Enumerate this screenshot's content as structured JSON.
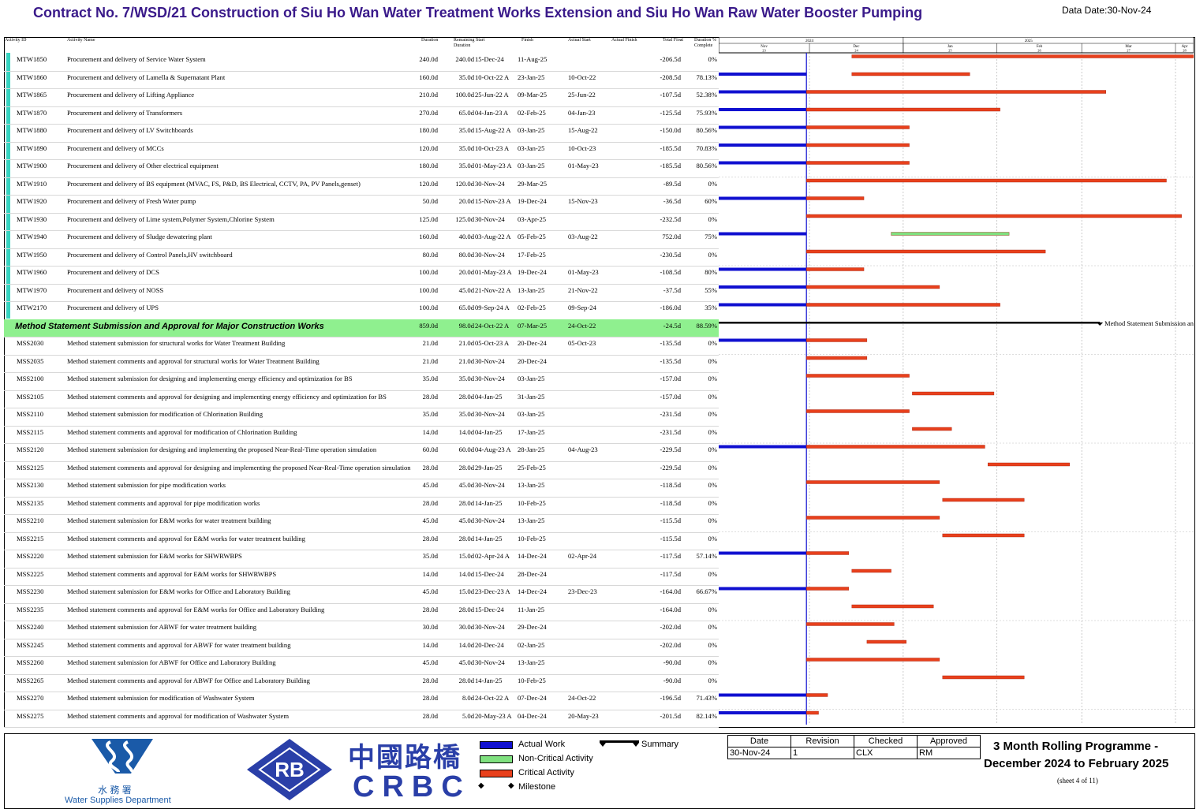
{
  "header": {
    "title": "Contract No. 7/WSD/21 Construction of Siu Ho Wan Water Treatment Works Extension and Siu Ho Wan Raw Water Booster Pumping",
    "data_date": "Data Date:30-Nov-24"
  },
  "columns": [
    "Activity ID",
    "Activity Name",
    "Duration",
    "Remaining Duration",
    "Start",
    "Finish",
    "Actual Start",
    "Actual Finish",
    "Total Float",
    "Duration % Complete"
  ],
  "timescale": {
    "years": [
      "2024",
      "2025"
    ],
    "months": [
      "Nov",
      "Dec",
      "Jan",
      "Feb",
      "Mar",
      "Apr"
    ],
    "months_num": [
      "23",
      "24",
      "25",
      "26",
      "27",
      "28"
    ]
  },
  "rows": [
    {
      "id": "MTW1850",
      "name": "Procurement and delivery of Service Water System",
      "od": "240.0d",
      "rd": "240.0d",
      "start": "15-Dec-24",
      "finish": "11-Aug-25",
      "as": "",
      "af": "",
      "tf": "-206.5d",
      "pc": "0%"
    },
    {
      "id": "MTW1860",
      "name": "Procurement and delivery of Lamella & Supernatant Plant",
      "od": "160.0d",
      "rd": "35.0d",
      "start": "10-Oct-22 A",
      "finish": "23-Jan-25",
      "as": "10-Oct-22",
      "af": "",
      "tf": "-208.5d",
      "pc": "78.13%"
    },
    {
      "id": "MTW1865",
      "name": "Procurement and delivery of Lifting Appliance",
      "od": "210.0d",
      "rd": "100.0d",
      "start": "25-Jun-22 A",
      "finish": "09-Mar-25",
      "as": "25-Jun-22",
      "af": "",
      "tf": "-107.5d",
      "pc": "52.38%"
    },
    {
      "id": "MTW1870",
      "name": "Procurement and delivery of Transformers",
      "od": "270.0d",
      "rd": "65.0d",
      "start": "04-Jan-23 A",
      "finish": "02-Feb-25",
      "as": "04-Jan-23",
      "af": "",
      "tf": "-125.5d",
      "pc": "75.93%"
    },
    {
      "id": "MTW1880",
      "name": "Procurement and delivery of LV Switchboards",
      "od": "180.0d",
      "rd": "35.0d",
      "start": "15-Aug-22 A",
      "finish": "03-Jan-25",
      "as": "15-Aug-22",
      "af": "",
      "tf": "-150.0d",
      "pc": "80.56%"
    },
    {
      "id": "MTW1890",
      "name": "Procurement and delivery of MCCs",
      "od": "120.0d",
      "rd": "35.0d",
      "start": "10-Oct-23 A",
      "finish": "03-Jan-25",
      "as": "10-Oct-23",
      "af": "",
      "tf": "-185.5d",
      "pc": "70.83%"
    },
    {
      "id": "MTW1900",
      "name": "Procurement and delivery of Other electrical equipment",
      "od": "180.0d",
      "rd": "35.0d",
      "start": "01-May-23 A",
      "finish": "03-Jan-25",
      "as": "01-May-23",
      "af": "",
      "tf": "-185.5d",
      "pc": "80.56%"
    },
    {
      "id": "MTW1910",
      "name": "Procurement and delivery of BS equipment (MVAC, FS, P&D, BS Electrical, CCTV, PA, PV Panels,genset)",
      "od": "120.0d",
      "rd": "120.0d",
      "start": "30-Nov-24",
      "finish": "29-Mar-25",
      "as": "",
      "af": "",
      "tf": "-89.5d",
      "pc": "0%"
    },
    {
      "id": "MTW1920",
      "name": "Procurement and delivery of Fresh Water pump",
      "od": "50.0d",
      "rd": "20.0d",
      "start": "15-Nov-23 A",
      "finish": "19-Dec-24",
      "as": "15-Nov-23",
      "af": "",
      "tf": "-36.5d",
      "pc": "60%"
    },
    {
      "id": "MTW1930",
      "name": "Procurement and delivery of Lime system,Polymer System,Chlorine System",
      "od": "125.0d",
      "rd": "125.0d",
      "start": "30-Nov-24",
      "finish": "03-Apr-25",
      "as": "",
      "af": "",
      "tf": "-232.5d",
      "pc": "0%"
    },
    {
      "id": "MTW1940",
      "name": "Procurement and delivery of Sludge dewatering plant",
      "od": "160.0d",
      "rd": "40.0d",
      "start": "03-Aug-22 A",
      "finish": "05-Feb-25",
      "as": "03-Aug-22",
      "af": "",
      "tf": "752.0d",
      "pc": "75%"
    },
    {
      "id": "MTW1950",
      "name": "Procurement and delivery of Control Panels,HV switchboard",
      "od": "80.0d",
      "rd": "80.0d",
      "start": "30-Nov-24",
      "finish": "17-Feb-25",
      "as": "",
      "af": "",
      "tf": "-230.5d",
      "pc": "0%"
    },
    {
      "id": "MTW1960",
      "name": "Procurement and delivery of DCS",
      "od": "100.0d",
      "rd": "20.0d",
      "start": "01-May-23 A",
      "finish": "19-Dec-24",
      "as": "01-May-23",
      "af": "",
      "tf": "-108.5d",
      "pc": "80%"
    },
    {
      "id": "MTW1970",
      "name": "Procurement and delivery of NOSS",
      "od": "100.0d",
      "rd": "45.0d",
      "start": "21-Nov-22 A",
      "finish": "13-Jan-25",
      "as": "21-Nov-22",
      "af": "",
      "tf": "-37.5d",
      "pc": "55%"
    },
    {
      "id": "MTW2170",
      "name": "Procurement and delivery of UPS",
      "od": "100.0d",
      "rd": "65.0d",
      "start": "09-Sep-24 A",
      "finish": "02-Feb-25",
      "as": "09-Sep-24",
      "af": "",
      "tf": "-186.0d",
      "pc": "35%"
    },
    {
      "id": "",
      "name": "Method Statement Submission and Approval for Major Construction Works",
      "od": "859.0d",
      "rd": "98.0d",
      "start": "24-Oct-22 A",
      "finish": "07-Mar-25",
      "as": "24-Oct-22",
      "af": "",
      "tf": "-24.5d",
      "pc": "88.59%",
      "group": true
    },
    {
      "id": "MSS2030",
      "name": "Method statement submission for structural works for Water Treatment Building",
      "od": "21.0d",
      "rd": "21.0d",
      "start": "05-Oct-23 A",
      "finish": "20-Dec-24",
      "as": "05-Oct-23",
      "af": "",
      "tf": "-135.5d",
      "pc": "0%"
    },
    {
      "id": "MSS2035",
      "name": "Method statement comments and approval for structural works for Water Treatment Building",
      "od": "21.0d",
      "rd": "21.0d",
      "start": "30-Nov-24",
      "finish": "20-Dec-24",
      "as": "",
      "af": "",
      "tf": "-135.5d",
      "pc": "0%"
    },
    {
      "id": "MSS2100",
      "name": "Method statement submission for designing and implementing energy efficiency and optimization for BS",
      "od": "35.0d",
      "rd": "35.0d",
      "start": "30-Nov-24",
      "finish": "03-Jan-25",
      "as": "",
      "af": "",
      "tf": "-157.0d",
      "pc": "0%"
    },
    {
      "id": "MSS2105",
      "name": "Method statement comments and approval for designing and implementing energy efficiency and optimization for BS",
      "od": "28.0d",
      "rd": "28.0d",
      "start": "04-Jan-25",
      "finish": "31-Jan-25",
      "as": "",
      "af": "",
      "tf": "-157.0d",
      "pc": "0%"
    },
    {
      "id": "MSS2110",
      "name": "Method statement submission for modification of Chlorination Building",
      "od": "35.0d",
      "rd": "35.0d",
      "start": "30-Nov-24",
      "finish": "03-Jan-25",
      "as": "",
      "af": "",
      "tf": "-231.5d",
      "pc": "0%"
    },
    {
      "id": "MSS2115",
      "name": "Method statement  comments and approval for modification of Chlorination Building",
      "od": "14.0d",
      "rd": "14.0d",
      "start": "04-Jan-25",
      "finish": "17-Jan-25",
      "as": "",
      "af": "",
      "tf": "-231.5d",
      "pc": "0%"
    },
    {
      "id": "MSS2120",
      "name": "Method statement submission for designing and implementing the proposed Near-Real-Time operation simulation",
      "od": "60.0d",
      "rd": "60.0d",
      "start": "04-Aug-23 A",
      "finish": "28-Jan-25",
      "as": "04-Aug-23",
      "af": "",
      "tf": "-229.5d",
      "pc": "0%"
    },
    {
      "id": "MSS2125",
      "name": "Method statement comments and approval for designing and implementing the proposed Near-Real-Time operation simulation",
      "od": "28.0d",
      "rd": "28.0d",
      "start": "29-Jan-25",
      "finish": "25-Feb-25",
      "as": "",
      "af": "",
      "tf": "-229.5d",
      "pc": "0%"
    },
    {
      "id": "MSS2130",
      "name": "Method statement submission for pipe modification works",
      "od": "45.0d",
      "rd": "45.0d",
      "start": "30-Nov-24",
      "finish": "13-Jan-25",
      "as": "",
      "af": "",
      "tf": "-118.5d",
      "pc": "0%"
    },
    {
      "id": "MSS2135",
      "name": "Method statement comments and approval for pipe modification works",
      "od": "28.0d",
      "rd": "28.0d",
      "start": "14-Jan-25",
      "finish": "10-Feb-25",
      "as": "",
      "af": "",
      "tf": "-118.5d",
      "pc": "0%"
    },
    {
      "id": "MSS2210",
      "name": "Method statement submission for E&M works for water treatment building",
      "od": "45.0d",
      "rd": "45.0d",
      "start": "30-Nov-24",
      "finish": "13-Jan-25",
      "as": "",
      "af": "",
      "tf": "-115.5d",
      "pc": "0%"
    },
    {
      "id": "MSS2215",
      "name": "Method statement comments and approval for E&M works for water treatment building",
      "od": "28.0d",
      "rd": "28.0d",
      "start": "14-Jan-25",
      "finish": "10-Feb-25",
      "as": "",
      "af": "",
      "tf": "-115.5d",
      "pc": "0%"
    },
    {
      "id": "MSS2220",
      "name": "Method statement submission for E&M works for SHWRWBPS",
      "od": "35.0d",
      "rd": "15.0d",
      "start": "02-Apr-24 A",
      "finish": "14-Dec-24",
      "as": "02-Apr-24",
      "af": "",
      "tf": "-117.5d",
      "pc": "57.14%"
    },
    {
      "id": "MSS2225",
      "name": "Method statement comments and approval for E&M works for SHWRWBPS",
      "od": "14.0d",
      "rd": "14.0d",
      "start": "15-Dec-24",
      "finish": "28-Dec-24",
      "as": "",
      "af": "",
      "tf": "-117.5d",
      "pc": "0%"
    },
    {
      "id": "MSS2230",
      "name": "Method statement submission for E&M works for Office and Laboratory Building",
      "od": "45.0d",
      "rd": "15.0d",
      "start": "23-Dec-23 A",
      "finish": "14-Dec-24",
      "as": "23-Dec-23",
      "af": "",
      "tf": "-164.0d",
      "pc": "66.67%"
    },
    {
      "id": "MSS2235",
      "name": "Method statement comments and approval for E&M works for Office and Laboratory Building",
      "od": "28.0d",
      "rd": "28.0d",
      "start": "15-Dec-24",
      "finish": "11-Jan-25",
      "as": "",
      "af": "",
      "tf": "-164.0d",
      "pc": "0%"
    },
    {
      "id": "MSS2240",
      "name": "Method statement submission for ABWF for water treatment building",
      "od": "30.0d",
      "rd": "30.0d",
      "start": "30-Nov-24",
      "finish": "29-Dec-24",
      "as": "",
      "af": "",
      "tf": "-202.0d",
      "pc": "0%"
    },
    {
      "id": "MSS2245",
      "name": "Method statement comments and approval for ABWF for water treatment building",
      "od": "14.0d",
      "rd": "14.0d",
      "start": "20-Dec-24",
      "finish": "02-Jan-25",
      "as": "",
      "af": "",
      "tf": "-202.0d",
      "pc": "0%"
    },
    {
      "id": "MSS2260",
      "name": "Method statement submission for ABWF for Office and Laboratory Building",
      "od": "45.0d",
      "rd": "45.0d",
      "start": "30-Nov-24",
      "finish": "13-Jan-25",
      "as": "",
      "af": "",
      "tf": "-90.0d",
      "pc": "0%"
    },
    {
      "id": "MSS2265",
      "name": "Method statement comments and approval for ABWF for Office and Laboratory Building",
      "od": "28.0d",
      "rd": "28.0d",
      "start": "14-Jan-25",
      "finish": "10-Feb-25",
      "as": "",
      "af": "",
      "tf": "-90.0d",
      "pc": "0%"
    },
    {
      "id": "MSS2270",
      "name": "Method statement submission for modification of Washwater System",
      "od": "28.0d",
      "rd": "8.0d",
      "start": "24-Oct-22 A",
      "finish": "07-Dec-24",
      "as": "24-Oct-22",
      "af": "",
      "tf": "-196.5d",
      "pc": "71.43%"
    },
    {
      "id": "MSS2275",
      "name": "Method statement comments and approval for modification of Washwater System",
      "od": "28.0d",
      "rd": "5.0d",
      "start": "20-May-23 A",
      "finish": "04-Dec-24",
      "as": "20-May-23",
      "af": "",
      "tf": "-201.5d",
      "pc": "82.14%"
    }
  ],
  "chart_data": {
    "type": "gantt",
    "data_date": "30-Nov-24",
    "x_range": [
      "01-Nov-24",
      "07-Apr-25"
    ],
    "x_ticks": [
      "Nov",
      "Dec",
      "Jan",
      "Feb",
      "Mar",
      "Apr"
    ],
    "summary_label": "Method Statement Submission and",
    "bars": [
      {
        "id": "MTW1850",
        "actual": false,
        "start": "15-Dec-24",
        "finish": "11-Aug-25",
        "kind": "critical"
      },
      {
        "id": "MTW1860",
        "actual": true,
        "start": "10-Oct-22",
        "finish": "23-Jan-25",
        "kind": "critical",
        "remaining_start": "15-Dec-24"
      },
      {
        "id": "MTW1865",
        "actual": true,
        "start": "25-Jun-22",
        "finish": "09-Mar-25",
        "kind": "critical"
      },
      {
        "id": "MTW1870",
        "actual": true,
        "start": "04-Jan-23",
        "finish": "02-Feb-25",
        "kind": "critical"
      },
      {
        "id": "MTW1880",
        "actual": true,
        "start": "15-Aug-22",
        "finish": "03-Jan-25",
        "kind": "critical"
      },
      {
        "id": "MTW1890",
        "actual": true,
        "start": "10-Oct-23",
        "finish": "03-Jan-25",
        "kind": "critical"
      },
      {
        "id": "MTW1900",
        "actual": true,
        "start": "01-May-23",
        "finish": "03-Jan-25",
        "kind": "critical"
      },
      {
        "id": "MTW1910",
        "actual": false,
        "start": "30-Nov-24",
        "finish": "29-Mar-25",
        "kind": "critical"
      },
      {
        "id": "MTW1920",
        "actual": true,
        "start": "15-Nov-23",
        "finish": "19-Dec-24",
        "kind": "critical"
      },
      {
        "id": "MTW1930",
        "actual": false,
        "start": "30-Nov-24",
        "finish": "03-Apr-25",
        "kind": "critical"
      },
      {
        "id": "MTW1940",
        "actual": true,
        "start": "03-Aug-22",
        "finish": "05-Feb-25",
        "kind": "noncritical",
        "remaining_start": "28-Dec-24"
      },
      {
        "id": "MTW1950",
        "actual": false,
        "start": "30-Nov-24",
        "finish": "17-Feb-25",
        "kind": "critical"
      },
      {
        "id": "MTW1960",
        "actual": true,
        "start": "01-May-23",
        "finish": "19-Dec-24",
        "kind": "critical"
      },
      {
        "id": "MTW1970",
        "actual": true,
        "start": "21-Nov-22",
        "finish": "13-Jan-25",
        "kind": "critical"
      },
      {
        "id": "MTW2170",
        "actual": true,
        "start": "09-Sep-24",
        "finish": "02-Feb-25",
        "kind": "critical"
      },
      {
        "id": "GROUP",
        "actual": false,
        "start": "24-Oct-22",
        "finish": "07-Mar-25",
        "kind": "summary"
      },
      {
        "id": "MSS2030",
        "actual": true,
        "start": "05-Oct-23",
        "finish": "20-Dec-24",
        "kind": "critical"
      },
      {
        "id": "MSS2035",
        "actual": false,
        "start": "30-Nov-24",
        "finish": "20-Dec-24",
        "kind": "critical"
      },
      {
        "id": "MSS2100",
        "actual": false,
        "start": "30-Nov-24",
        "finish": "03-Jan-25",
        "kind": "critical"
      },
      {
        "id": "MSS2105",
        "actual": false,
        "start": "04-Jan-25",
        "finish": "31-Jan-25",
        "kind": "critical"
      },
      {
        "id": "MSS2110",
        "actual": false,
        "start": "30-Nov-24",
        "finish": "03-Jan-25",
        "kind": "critical"
      },
      {
        "id": "MSS2115",
        "actual": false,
        "start": "04-Jan-25",
        "finish": "17-Jan-25",
        "kind": "critical"
      },
      {
        "id": "MSS2120",
        "actual": true,
        "start": "04-Aug-23",
        "finish": "28-Jan-25",
        "kind": "critical"
      },
      {
        "id": "MSS2125",
        "actual": false,
        "start": "29-Jan-25",
        "finish": "25-Feb-25",
        "kind": "critical"
      },
      {
        "id": "MSS2130",
        "actual": false,
        "start": "30-Nov-24",
        "finish": "13-Jan-25",
        "kind": "critical"
      },
      {
        "id": "MSS2135",
        "actual": false,
        "start": "14-Jan-25",
        "finish": "10-Feb-25",
        "kind": "critical"
      },
      {
        "id": "MSS2210",
        "actual": false,
        "start": "30-Nov-24",
        "finish": "13-Jan-25",
        "kind": "critical"
      },
      {
        "id": "MSS2215",
        "actual": false,
        "start": "14-Jan-25",
        "finish": "10-Feb-25",
        "kind": "critical"
      },
      {
        "id": "MSS2220",
        "actual": true,
        "start": "02-Apr-24",
        "finish": "14-Dec-24",
        "kind": "critical"
      },
      {
        "id": "MSS2225",
        "actual": false,
        "start": "15-Dec-24",
        "finish": "28-Dec-24",
        "kind": "critical"
      },
      {
        "id": "MSS2230",
        "actual": true,
        "start": "23-Dec-23",
        "finish": "14-Dec-24",
        "kind": "critical"
      },
      {
        "id": "MSS2235",
        "actual": false,
        "start": "15-Dec-24",
        "finish": "11-Jan-25",
        "kind": "critical"
      },
      {
        "id": "MSS2240",
        "actual": false,
        "start": "30-Nov-24",
        "finish": "29-Dec-24",
        "kind": "critical"
      },
      {
        "id": "MSS2245",
        "actual": false,
        "start": "20-Dec-24",
        "finish": "02-Jan-25",
        "kind": "critical"
      },
      {
        "id": "MSS2260",
        "actual": false,
        "start": "30-Nov-24",
        "finish": "13-Jan-25",
        "kind": "critical"
      },
      {
        "id": "MSS2265",
        "actual": false,
        "start": "14-Jan-25",
        "finish": "10-Feb-25",
        "kind": "critical"
      },
      {
        "id": "MSS2270",
        "actual": true,
        "start": "24-Oct-22",
        "finish": "07-Dec-24",
        "kind": "critical"
      },
      {
        "id": "MSS2275",
        "actual": true,
        "start": "20-May-23",
        "finish": "04-Dec-24",
        "kind": "critical"
      }
    ]
  },
  "legend": {
    "actual_work": "Actual Work",
    "non_critical": "Non-Critical Activity",
    "critical": "Critical Activity",
    "milestone": "Milestone",
    "summary": "Summary"
  },
  "colors": {
    "actual": "#1010d0",
    "critical": "#e8401c",
    "noncritical": "#7fe07f",
    "group_band": "#8ff08f",
    "title": "#3a1a8a",
    "wsd_blue": "#1a5aa8",
    "crbc_blue": "#2a3fa8"
  },
  "signoff": {
    "headers": [
      "Date",
      "Revision",
      "Checked",
      "Approved"
    ],
    "values": [
      "30-Nov-24",
      "1",
      "CLX",
      "RM"
    ]
  },
  "programme": {
    "line1": "3 Month Rolling Programme -",
    "line2": "December 2024 to February 2025",
    "sheet": "(sheet 4 of 11)"
  },
  "logos": {
    "wsd_chinese": "水 務 署",
    "wsd_english": "Water Supplies Department",
    "rb_mark": "RB",
    "crbc_chinese": "中國路橋",
    "crbc_english": "CRBC"
  }
}
